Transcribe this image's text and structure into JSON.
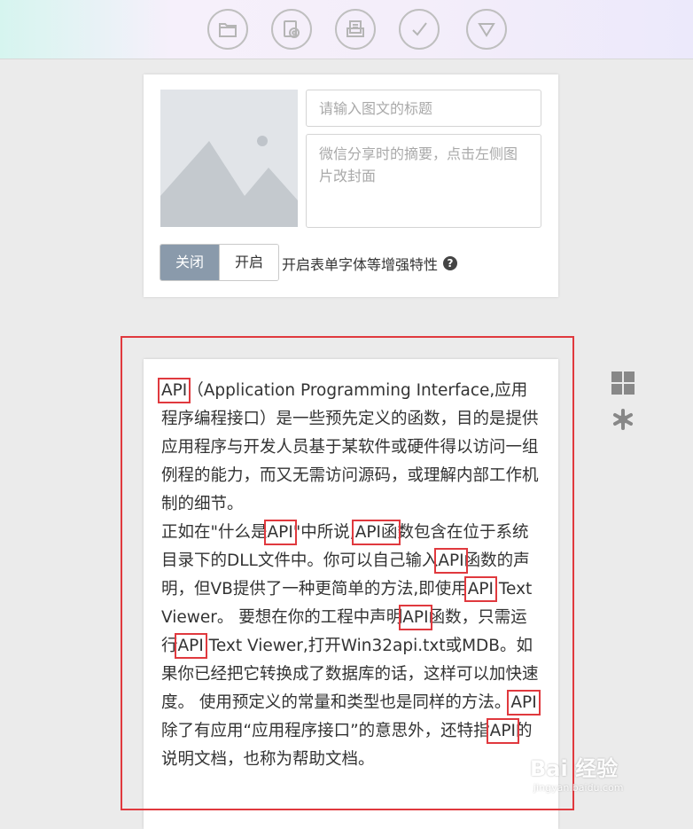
{
  "toolbar": {
    "icons": [
      "folder-icon",
      "video-icon",
      "document-icon",
      "check-icon",
      "triangle-down-icon"
    ]
  },
  "cover": {
    "title_placeholder": "请输入图文的标题",
    "summary_placeholder": "微信分享时的摘要，点击左侧图片改封面"
  },
  "enhance": {
    "off_label": "关闭",
    "on_label": "开启",
    "description": "开启表单字体等增强特性",
    "help_icon": "?"
  },
  "article": {
    "paragraphs": [
      [
        {
          "t": "API",
          "hl": true
        },
        {
          "t": "（Application Programming Interface,应用程序编程接口）是一些预先定义的函数，目的是提供应用程序与开发人员基于某软件或硬件得以访问一组例程的能力，而又无需访问源码，或理解内部工作机制的细节。"
        }
      ],
      [
        {
          "t": "正如在\"什么是"
        },
        {
          "t": "API",
          "hl": true
        },
        {
          "t": "\"中所说,"
        },
        {
          "t": "API函",
          "hl": true
        },
        {
          "t": "数包含在位于系统目录下的DLL文件中。你可以自己输入"
        },
        {
          "t": "API",
          "hl": true
        },
        {
          "t": "函数的声明，但VB提供了一种更简单的方法,即使用"
        },
        {
          "t": "API",
          "hl": true
        },
        {
          "t": " Text Viewer。 要想在你的工程中声明"
        },
        {
          "t": "API",
          "hl": true
        },
        {
          "t": "函数，只需运行"
        },
        {
          "t": "API",
          "hl": true
        },
        {
          "t": " Text Viewer,打开Win32api.txt或MDB。如果你已经把它转换成了数据库的话，这样可以加快速度。 使用预定义的常量和类型也是同样的方法。"
        },
        {
          "t": "API",
          "hl": true
        },
        {
          "t": "除了有应用“应用程序接口”的意思外，还特指"
        },
        {
          "t": "API",
          "hl": true
        },
        {
          "t": "的说明文档，也称为帮助文档。"
        }
      ]
    ]
  },
  "side_tools": [
    "grid-icon",
    "gear-icon"
  ],
  "watermark": {
    "logo_text": "Bai 经验",
    "url": "jingyan.baidu.com"
  },
  "colors": {
    "highlight": "#e0393e",
    "toggle_active": "#8a9aab"
  }
}
